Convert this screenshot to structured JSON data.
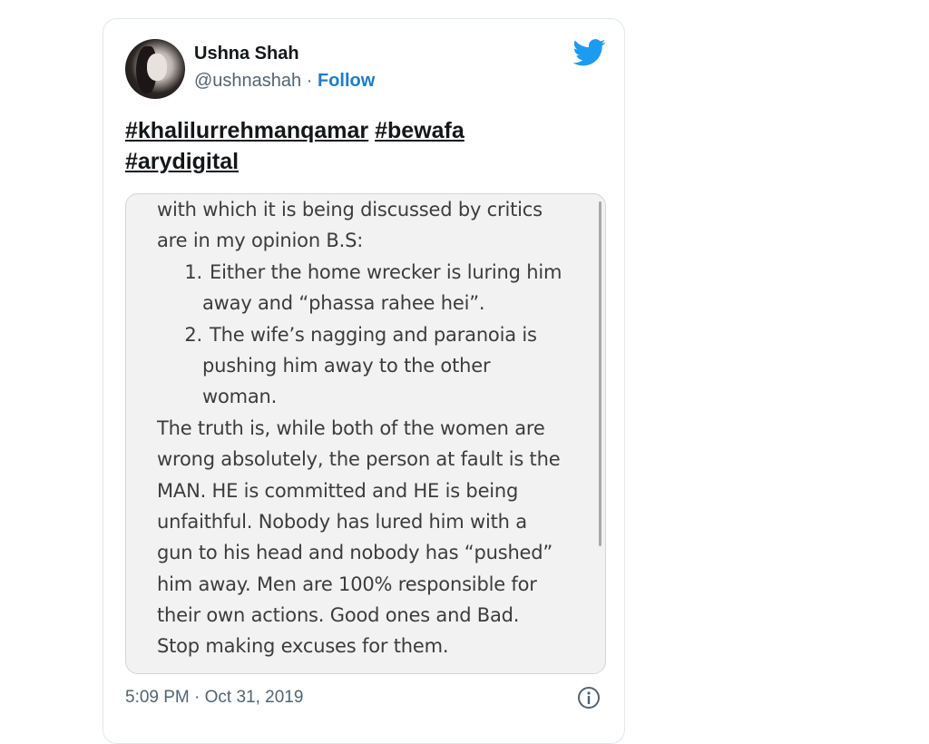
{
  "user": {
    "name": "Ushna Shah",
    "handle": "@ushnashah",
    "separator": " · ",
    "follow_label": "Follow"
  },
  "tweet": {
    "hashtags": [
      "#khalilurrehmanqamar",
      "#bewafa",
      "#arydigital"
    ],
    "timestamp": "5:09 PM · Oct 31, 2019"
  },
  "image_text": {
    "intro_lines": [
      "with which it is being discussed by critics",
      "are in my opinion B.S:"
    ],
    "list_items": [
      {
        "num": "1.",
        "lines": [
          "Either the home wrecker is luring him",
          "away and “phassa rahee hei”."
        ]
      },
      {
        "num": "2.",
        "lines": [
          "The wife’s nagging and paranoia is",
          "pushing him away to the other",
          "woman."
        ]
      }
    ],
    "body_lines": [
      "The truth is, while both of the women are",
      "wrong absolutely, the person at fault is the",
      "MAN. HE is committed and HE is being",
      "unfaithful. Nobody has lured him with a",
      "gun to his head and nobody has “pushed”",
      "him away. Men are 100% responsible for",
      "their own actions. Good ones and Bad.",
      "Stop making excuses for them."
    ]
  },
  "icons": {
    "brand": "twitter-bird-icon",
    "info": "info-icon"
  },
  "colors": {
    "twitter_blue": "#1d9bf0",
    "follow_blue": "#1d7cc9",
    "text_dark": "#14171a",
    "text_muted": "#536471"
  }
}
